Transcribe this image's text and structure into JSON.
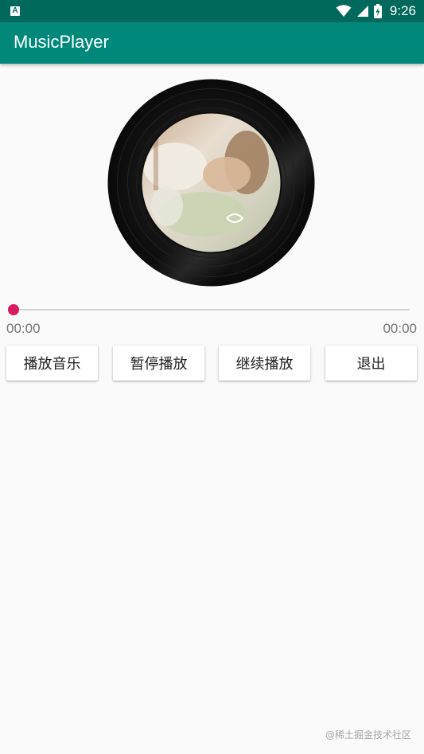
{
  "status_bar": {
    "app_icon_label": "A",
    "time": "9:26",
    "icons": [
      "wifi-icon",
      "cellular-signal-icon",
      "battery-charging-icon"
    ]
  },
  "app_bar": {
    "title": "MusicPlayer"
  },
  "player": {
    "album_art": "vinyl-disc-album-art",
    "progress": 0,
    "current_time": "00:00",
    "total_time": "00:00"
  },
  "controls": {
    "play_label": "播放音乐",
    "pause_label": "暂停播放",
    "resume_label": "继续播放",
    "exit_label": "退出"
  },
  "watermark": "@稀土掘金技术社区",
  "colors": {
    "status_bar": "#00695c",
    "app_bar": "#00897b",
    "accent": "#d81b60",
    "background": "#fafafa"
  }
}
